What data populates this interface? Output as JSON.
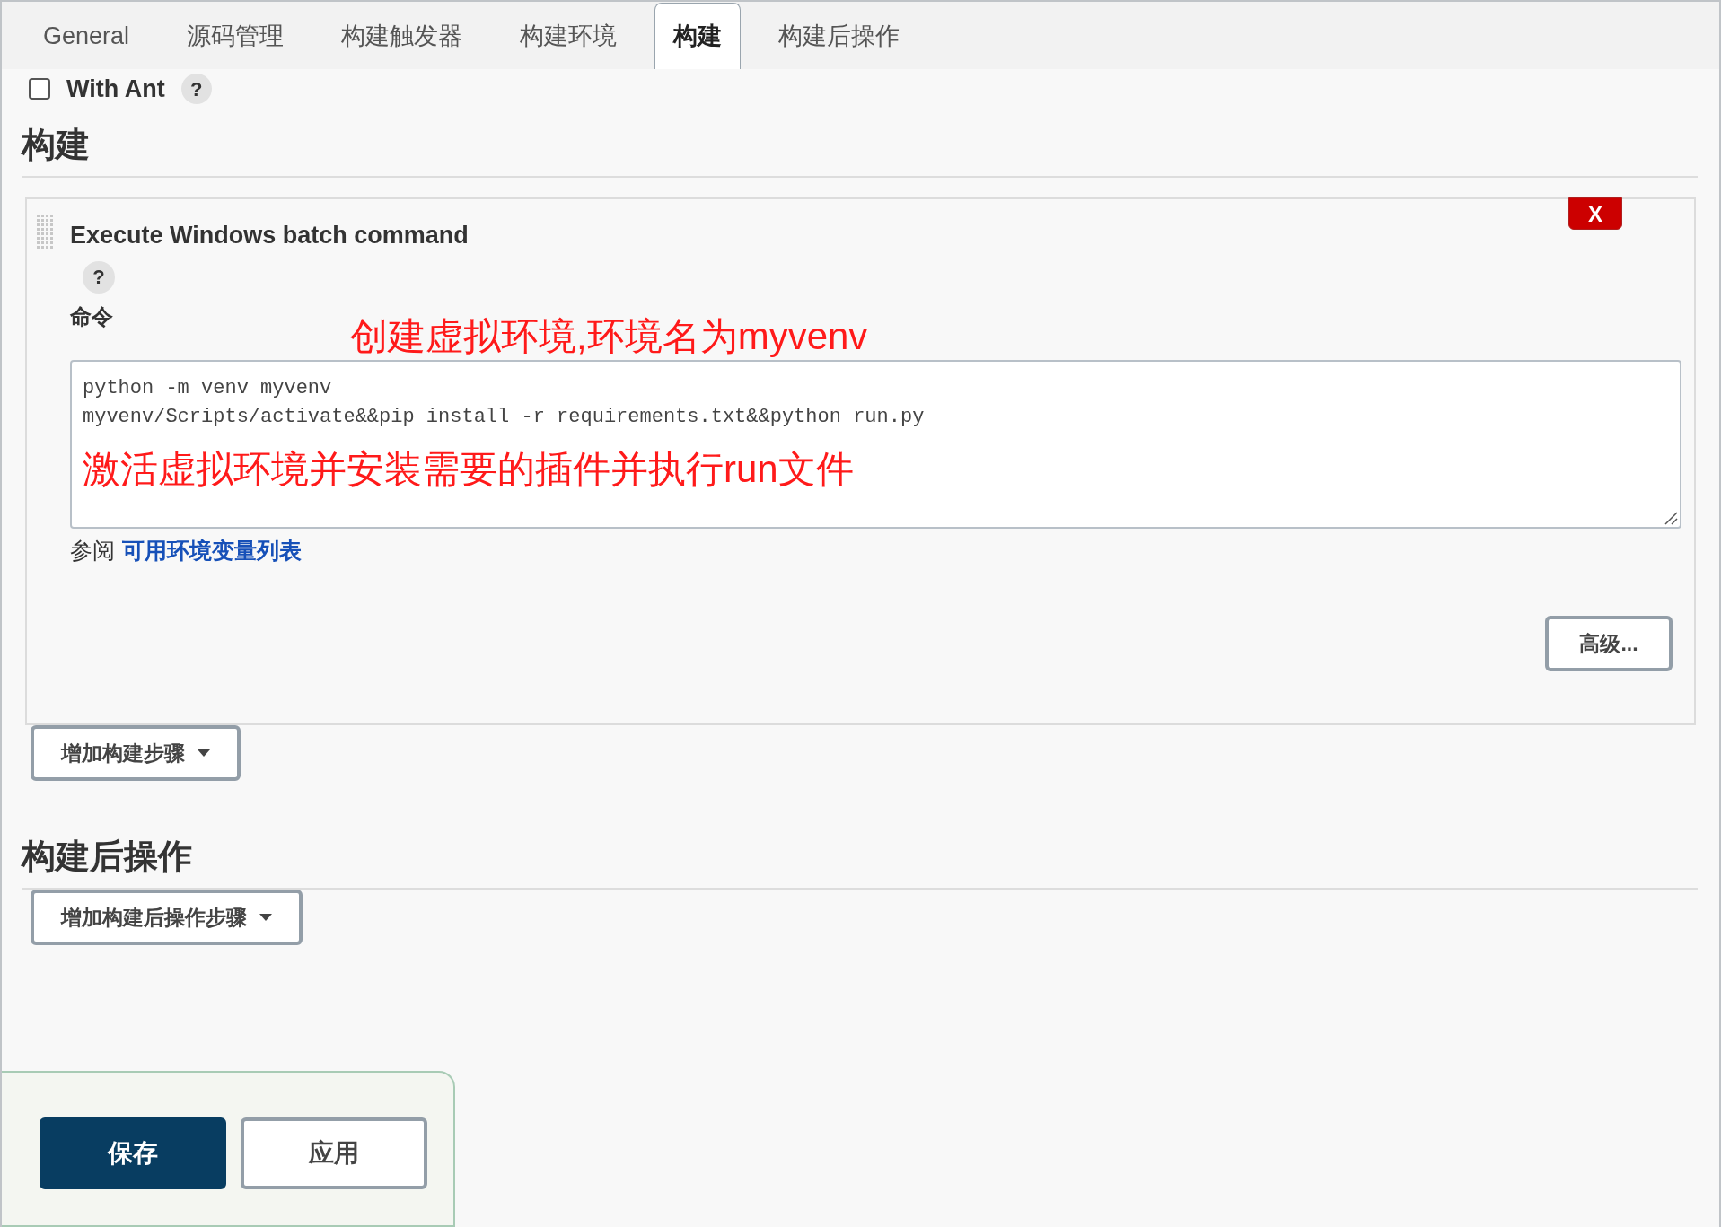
{
  "tabs": [
    {
      "label": "General",
      "selected": false
    },
    {
      "label": "源码管理",
      "selected": false
    },
    {
      "label": "构建触发器",
      "selected": false
    },
    {
      "label": "构建环境",
      "selected": false
    },
    {
      "label": "构建",
      "selected": true
    },
    {
      "label": "构建后操作",
      "selected": false
    }
  ],
  "options": [
    {
      "label": "With Ant",
      "checked": false,
      "help": "?"
    }
  ],
  "build": {
    "heading": "构建",
    "steps": [
      {
        "title": "Execute Windows batch command",
        "delete_label": "X",
        "help": "?",
        "command_label": "命令",
        "command_lines": [
          "python -m venv myvenv",
          "myvenv/Scripts/activate&&pip install -r requirements.txt&&python run.py"
        ],
        "see_also": "参阅",
        "link": "可用环境变量列表",
        "advanced_button": "高级..."
      }
    ],
    "add_button": "增加构建步骤"
  },
  "annotations": [
    {
      "text": "创建虚拟环境,环境名为myvenv",
      "kind": "top"
    },
    {
      "text": "激活虚拟环境并安装需要的插件并执行run文件",
      "kind": "bottom"
    }
  ],
  "post_build": {
    "heading": "构建后操作",
    "add_button": "增加构建后操作步骤"
  },
  "footer_buttons": [
    {
      "label": "保存",
      "kind": "primary"
    },
    {
      "label": "应用",
      "kind": "secondary"
    }
  ]
}
